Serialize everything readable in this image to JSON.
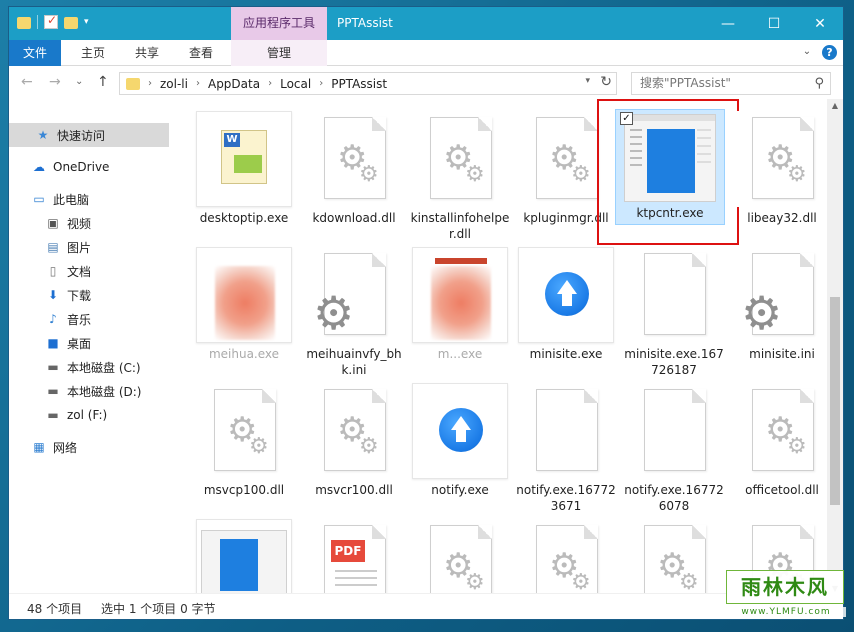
{
  "titlebar": {
    "context_tab": "应用程序工具",
    "title": "PPTAssist",
    "minimize": "—",
    "maximize": "☐",
    "close": "✕"
  },
  "ribbon": {
    "tabs": [
      "文件",
      "主页",
      "共享",
      "查看",
      "管理"
    ]
  },
  "address": {
    "back": "←",
    "forward": "→",
    "recent": "⌄",
    "up": "↑",
    "crumbs": [
      "zol-li",
      "AppData",
      "Local",
      "PPTAssist"
    ],
    "search_placeholder": "搜索\"PPTAssist\""
  },
  "nav": {
    "items": [
      {
        "label": "快速访问",
        "icon": "star-icon"
      },
      {
        "label": "OneDrive",
        "icon": "cloud-icon"
      },
      {
        "label": "此电脑",
        "icon": "computer-icon"
      },
      {
        "label": "视频",
        "icon": "video-icon"
      },
      {
        "label": "图片",
        "icon": "picture-icon"
      },
      {
        "label": "文档",
        "icon": "document-icon"
      },
      {
        "label": "下载",
        "icon": "download-icon"
      },
      {
        "label": "音乐",
        "icon": "music-icon"
      },
      {
        "label": "桌面",
        "icon": "desktop-icon"
      },
      {
        "label": "本地磁盘 (C:)",
        "icon": "drive-icon"
      },
      {
        "label": "本地磁盘 (D:)",
        "icon": "drive-icon"
      },
      {
        "label": "zol (F:)",
        "icon": "drive-icon"
      },
      {
        "label": "网络",
        "icon": "network-icon"
      }
    ]
  },
  "files": [
    {
      "name": "desktoptip.exe",
      "kind": "word"
    },
    {
      "name": "kdownload.dll",
      "kind": "gear"
    },
    {
      "name": "kinstallinfohelper.dll",
      "kind": "gear"
    },
    {
      "name": "kpluginmgr.dll",
      "kind": "gear"
    },
    {
      "name": "ktpcntr.exe",
      "kind": "app",
      "selected": true
    },
    {
      "name": "libeay32.dll",
      "kind": "gear"
    },
    {
      "name": "meihua.exe",
      "kind": "blur"
    },
    {
      "name": "meihuainvfy_bhk.ini",
      "kind": "ini"
    },
    {
      "name": "m...exe",
      "kind": "blur2"
    },
    {
      "name": "minisite.exe",
      "kind": "arrow"
    },
    {
      "name": "minisite.exe.167726187",
      "kind": "blank"
    },
    {
      "name": "minisite.ini",
      "kind": "ini"
    },
    {
      "name": "msvcp100.dll",
      "kind": "gear"
    },
    {
      "name": "msvcr100.dll",
      "kind": "gear"
    },
    {
      "name": "notify.exe",
      "kind": "arrow"
    },
    {
      "name": "notify.exe.167723671",
      "kind": "blank"
    },
    {
      "name": "notify.exe.167726078",
      "kind": "blank"
    },
    {
      "name": "officetool.dll",
      "kind": "gear"
    },
    {
      "name": "",
      "kind": "app2"
    },
    {
      "name": "",
      "kind": "pdf"
    },
    {
      "name": "",
      "kind": "gear"
    },
    {
      "name": "",
      "kind": "gear"
    },
    {
      "name": "",
      "kind": "gear"
    },
    {
      "name": "",
      "kind": "gear"
    }
  ],
  "status": {
    "count": "48 个项目",
    "selection": "选中 1 个项目  0 字节"
  },
  "watermark": {
    "main": "雨林木风",
    "sub": "www.YLMFU.com"
  }
}
